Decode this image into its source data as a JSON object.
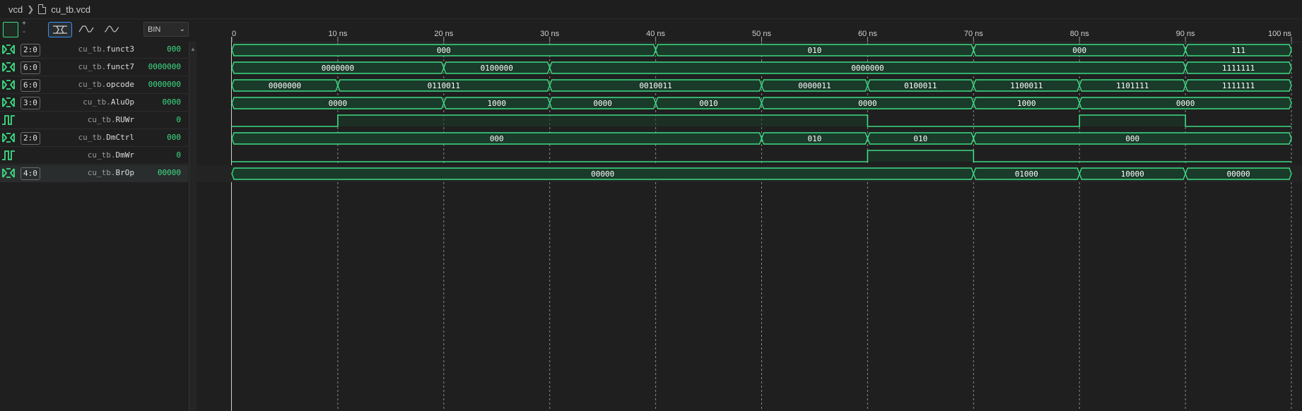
{
  "breadcrumb": {
    "folder": "vcd",
    "file": "cu_tb.vcd"
  },
  "toolbar": {
    "zoom_in": "+",
    "zoom_out": "-",
    "radix": "BIN",
    "accent_color": "#3ddc84"
  },
  "timeline": {
    "ticks": [
      "0",
      "10 ns",
      "20 ns",
      "30 ns",
      "40 ns",
      "50 ns",
      "60 ns",
      "70 ns",
      "80 ns",
      "90 ns",
      "100 ns"
    ]
  },
  "signals": [
    {
      "type": "bus",
      "width": "2:0",
      "scope": "cu_tb.",
      "name": "funct3",
      "value": "000",
      "segments": [
        {
          "start": 0,
          "end": 40,
          "value": "000"
        },
        {
          "start": 40,
          "end": 70,
          "value": "010"
        },
        {
          "start": 70,
          "end": 90,
          "value": "000"
        },
        {
          "start": 90,
          "end": 100,
          "value": "111"
        }
      ]
    },
    {
      "type": "bus",
      "width": "6:0",
      "scope": "cu_tb.",
      "name": "funct7",
      "value": "0000000",
      "segments": [
        {
          "start": 0,
          "end": 20,
          "value": "0000000"
        },
        {
          "start": 20,
          "end": 30,
          "value": "0100000"
        },
        {
          "start": 30,
          "end": 90,
          "value": "0000000"
        },
        {
          "start": 90,
          "end": 100,
          "value": "1111111"
        }
      ]
    },
    {
      "type": "bus",
      "width": "6:0",
      "scope": "cu_tb.",
      "name": "opcode",
      "value": "0000000",
      "segments": [
        {
          "start": 0,
          "end": 10,
          "value": "0000000"
        },
        {
          "start": 10,
          "end": 30,
          "value": "0110011"
        },
        {
          "start": 30,
          "end": 50,
          "value": "0010011"
        },
        {
          "start": 50,
          "end": 60,
          "value": "0000011"
        },
        {
          "start": 60,
          "end": 70,
          "value": "0100011"
        },
        {
          "start": 70,
          "end": 80,
          "value": "1100011"
        },
        {
          "start": 80,
          "end": 90,
          "value": "1101111"
        },
        {
          "start": 90,
          "end": 100,
          "value": "1111111"
        }
      ]
    },
    {
      "type": "bus",
      "width": "3:0",
      "scope": "cu_tb.",
      "name": "AluOp",
      "value": "0000",
      "segments": [
        {
          "start": 0,
          "end": 20,
          "value": "0000"
        },
        {
          "start": 20,
          "end": 30,
          "value": "1000"
        },
        {
          "start": 30,
          "end": 40,
          "value": "0000"
        },
        {
          "start": 40,
          "end": 50,
          "value": "0010"
        },
        {
          "start": 50,
          "end": 70,
          "value": "0000"
        },
        {
          "start": 70,
          "end": 80,
          "value": "1000"
        },
        {
          "start": 80,
          "end": 100,
          "value": "0000"
        }
      ]
    },
    {
      "type": "bit",
      "width": "",
      "scope": "cu_tb.",
      "name": "RUWr",
      "value": "0",
      "levels": [
        {
          "start": 0,
          "end": 10,
          "level": 0
        },
        {
          "start": 10,
          "end": 60,
          "level": 1
        },
        {
          "start": 60,
          "end": 80,
          "level": 0
        },
        {
          "start": 80,
          "end": 90,
          "level": 1
        },
        {
          "start": 90,
          "end": 100,
          "level": 0
        }
      ]
    },
    {
      "type": "bus",
      "width": "2:0",
      "scope": "cu_tb.",
      "name": "DmCtrl",
      "value": "000",
      "segments": [
        {
          "start": 0,
          "end": 50,
          "value": "000"
        },
        {
          "start": 50,
          "end": 60,
          "value": "010"
        },
        {
          "start": 60,
          "end": 70,
          "value": "010"
        },
        {
          "start": 70,
          "end": 100,
          "value": "000"
        }
      ]
    },
    {
      "type": "bit",
      "width": "",
      "scope": "cu_tb.",
      "name": "DmWr",
      "value": "0",
      "levels": [
        {
          "start": 0,
          "end": 60,
          "level": 0
        },
        {
          "start": 60,
          "end": 70,
          "level": 1
        },
        {
          "start": 70,
          "end": 100,
          "level": 0
        }
      ]
    },
    {
      "type": "bus",
      "width": "4:0",
      "scope": "cu_tb.",
      "name": "BrOp",
      "value": "00000",
      "selected": true,
      "segments": [
        {
          "start": 0,
          "end": 70,
          "value": "00000"
        },
        {
          "start": 70,
          "end": 80,
          "value": "01000"
        },
        {
          "start": 80,
          "end": 90,
          "value": "10000"
        },
        {
          "start": 90,
          "end": 100,
          "value": "00000"
        }
      ]
    }
  ]
}
